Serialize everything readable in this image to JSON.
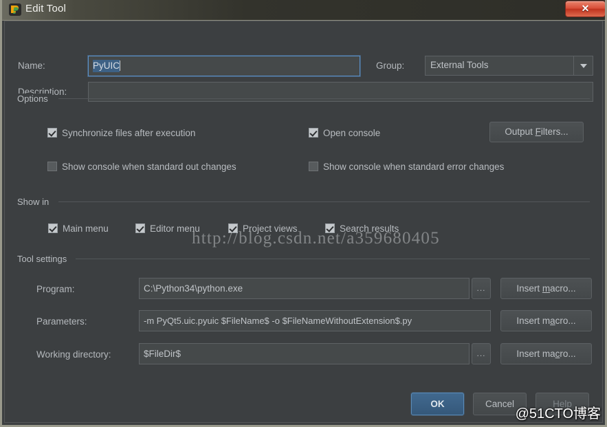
{
  "window": {
    "title": "Edit Tool",
    "icon": "pycharm-icon",
    "close_label": "✕",
    "accent_blue": "#3d6185",
    "title_bar_color": "#33332c",
    "dialog_bg": "#3c3f41",
    "close_button_color": "#d9503a"
  },
  "header": {
    "name_label": "Name:",
    "name_value": "PyUIC",
    "description_label": "Description:",
    "description_value": "",
    "description_placeholder": "",
    "group_label": "Group:",
    "group_value": "External Tools",
    "group_options": [
      "External Tools"
    ]
  },
  "options": {
    "section_title": "Options",
    "checkboxes": [
      {
        "label": "Synchronize files after execution",
        "checked": true
      },
      {
        "label": "Open console",
        "checked": true
      },
      {
        "label": "Show console when standard out changes",
        "checked": false
      },
      {
        "label": "Show console when standard error changes",
        "checked": false
      }
    ],
    "output_filters_button": "Output Filters...",
    "output_filters_mnemonic": "F"
  },
  "show_in": {
    "section_title": "Show in",
    "checkboxes": [
      {
        "label": "Main menu",
        "checked": true
      },
      {
        "label": "Editor menu",
        "checked": true
      },
      {
        "label": "Project views",
        "checked": true
      },
      {
        "label": "Search results",
        "checked": true
      }
    ]
  },
  "tool_settings": {
    "section_title": "Tool settings",
    "rows": [
      {
        "label": "Program:",
        "value": "C:\\Python34\\python.exe",
        "browse_label": "...",
        "has_browse": true,
        "macro_label": "Insert macro...",
        "macro_mnemonic": "m"
      },
      {
        "label": "Parameters:",
        "value": "-m PyQt5.uic.pyuic   $FileName$ -o $FileNameWithoutExtension$.py",
        "browse_label": "",
        "has_browse": false,
        "macro_label": "Insert macro...",
        "macro_mnemonic": "a"
      },
      {
        "label": "Working directory:",
        "value": "$FileDir$",
        "browse_label": "...",
        "has_browse": true,
        "macro_label": "Insert macro...",
        "macro_mnemonic": "c"
      }
    ]
  },
  "footer": {
    "ok_label": "OK",
    "cancel_label": "Cancel",
    "help_label": "Help"
  },
  "watermarks": {
    "url": "http://blog.csdn.net/a359680405",
    "site": "@51CTO博客"
  }
}
